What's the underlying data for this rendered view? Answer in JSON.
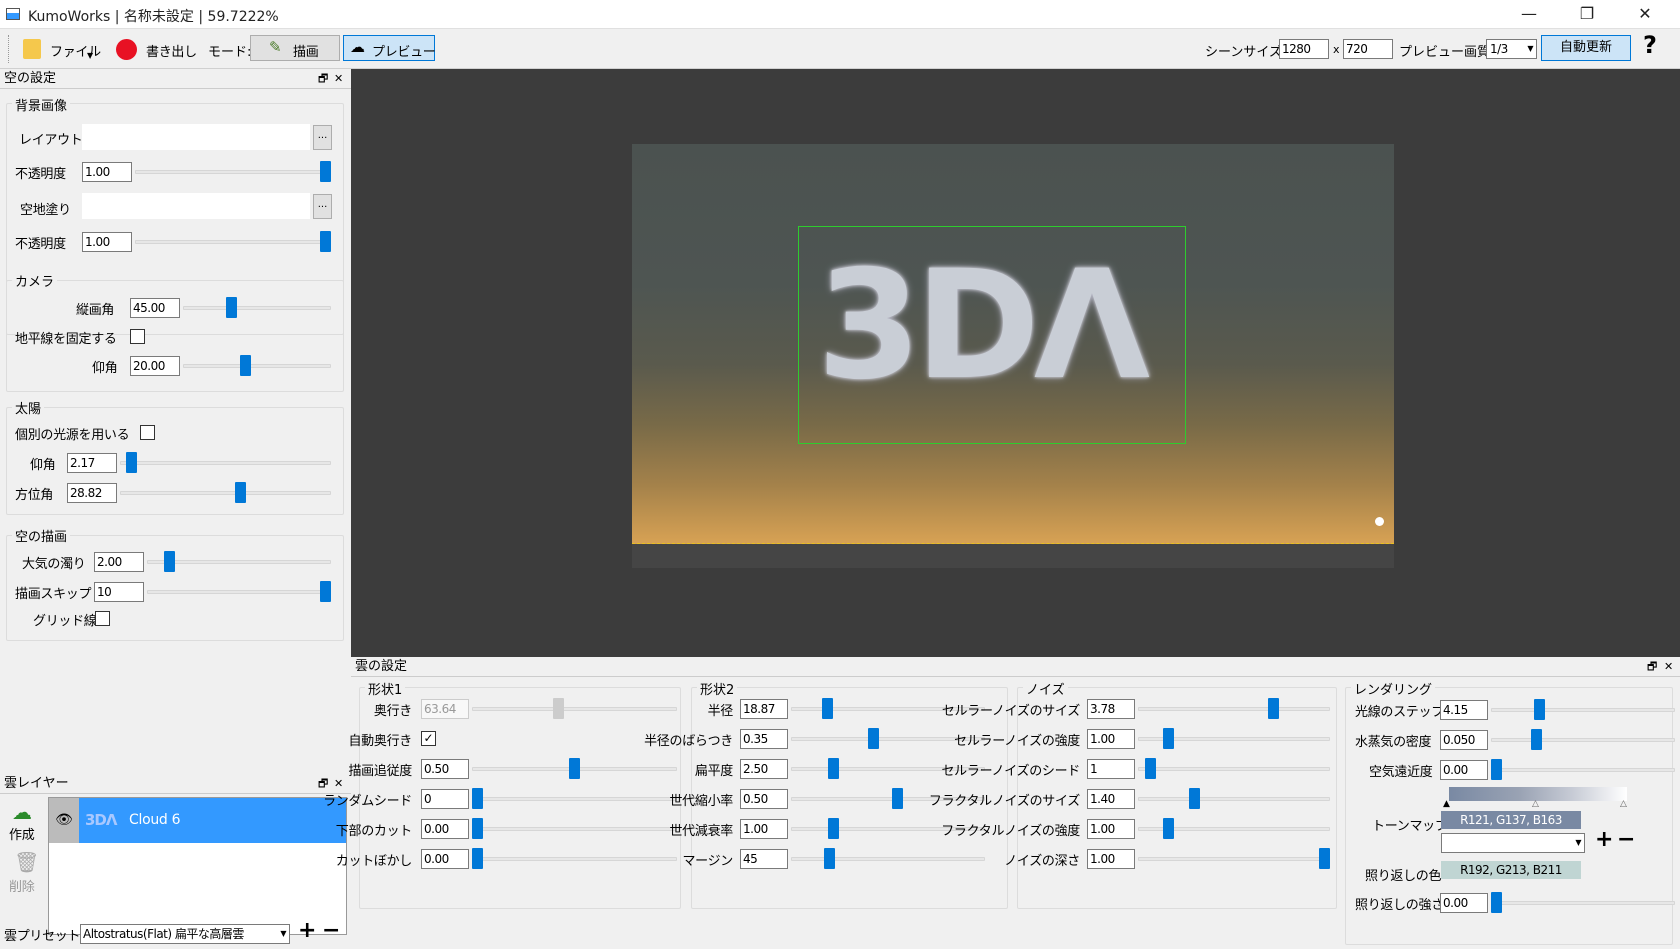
{
  "window": {
    "title": "KumoWorks | 名称未設定 | 59.7222%",
    "minimize": "—",
    "maximize": "❐",
    "close": "✕"
  },
  "toolbar": {
    "file": "ファイル",
    "export": "書き出し",
    "mode_label": "モード:",
    "draw": "描画",
    "preview": "プレビュー",
    "scene_size_label": "シーンサイズ:",
    "width": "1280",
    "x_sep": "x",
    "height": "720",
    "preview_quality_label": "プレビュー画質:",
    "preview_quality": "1/3",
    "auto_update": "自動更新",
    "help": "?"
  },
  "sky_panel": {
    "title": "空の設定",
    "background": {
      "title": "背景画像",
      "layout_label": "レイアウト",
      "layout_value": "",
      "browse": "...",
      "opacity_label": "不透明度",
      "opacity_value": "1.00",
      "opacity_level": 1.0,
      "ground_label": "空地塗り",
      "ground_value": "",
      "ground_opacity_label": "不透明度",
      "ground_opacity_value": "1.00",
      "ground_opacity_level": 1.0
    },
    "camera": {
      "title": "カメラ",
      "fov_label": "縦画角",
      "fov_value": "45.00",
      "fix_horizon_label": "地平線を固定する",
      "pitch_label": "仰角",
      "pitch_value": "20.00"
    },
    "sun": {
      "title": "太陽",
      "individual_light_label": "個別の光源を用いる",
      "elevation_label": "仰角",
      "elevation_value": "2.17",
      "azimuth_label": "方位角",
      "azimuth_value": "28.82"
    },
    "sky_render": {
      "title": "空の描画",
      "turbidity_label": "大気の濁り",
      "turbidity_value": "2.00",
      "skip_label": "描画スキップ",
      "skip_value": "10",
      "grid_label": "グリッド線"
    }
  },
  "layers_panel": {
    "title": "雲レイヤー",
    "create": "作成",
    "delete": "削除",
    "layers": [
      {
        "thumb": "3DΛ",
        "name": "Cloud 6"
      }
    ],
    "preset_label": "雲プリセット:",
    "preset_value": "Altostratus(Flat) 扁平な高層雲",
    "add": "+",
    "remove": "−"
  },
  "viewport": {
    "cloud_text": "3DΛ"
  },
  "cloud_panel": {
    "title": "雲の設定",
    "shape1": {
      "title": "形状1",
      "rows": [
        {
          "label": "奥行き",
          "value": "63.64",
          "level": 0.42,
          "disabled": true
        },
        {
          "label": "自動奥行き",
          "checkbox": true,
          "checked": true
        },
        {
          "label": "描画追従度",
          "value": "0.50",
          "level": 0.5
        },
        {
          "label": "ランダムシード",
          "value": "0",
          "level": 0.0
        },
        {
          "label": "下部のカット",
          "value": "0.00",
          "level": 0.0
        },
        {
          "label": "カットぼかし",
          "value": "0.00",
          "level": 0.0
        }
      ]
    },
    "shape2": {
      "title": "形状2",
      "rows": [
        {
          "label": "半径",
          "value": "18.87",
          "level": 0.17
        },
        {
          "label": "半径のばらつき",
          "value": "0.35",
          "level": 0.42
        },
        {
          "label": "扁平度",
          "value": "2.50",
          "level": 0.2
        },
        {
          "label": "世代縮小率",
          "value": "0.50",
          "level": 0.55
        },
        {
          "label": "世代減衰率",
          "value": "1.00",
          "level": 0.2
        },
        {
          "label": "マージン",
          "value": "45",
          "level": 0.18
        }
      ]
    },
    "noise": {
      "title": "ノイズ",
      "rows": [
        {
          "label": "セルラーノイズのサイズ",
          "value": "3.78",
          "level": 0.72
        },
        {
          "label": "セルラーノイズの強度",
          "value": "1.00",
          "level": 0.14
        },
        {
          "label": "セルラーノイズのシード",
          "value": "1",
          "level": 0.04
        },
        {
          "label": "フラクタルノイズのサイズ",
          "value": "1.40",
          "level": 0.28
        },
        {
          "label": "フラクタルノイズの強度",
          "value": "1.00",
          "level": 0.14
        },
        {
          "label": "ノイズの深さ",
          "value": "1.00",
          "level": 1.0
        }
      ]
    },
    "rendering": {
      "title": "レンダリング",
      "ray_step_label": "光線のステップ",
      "ray_step_value": "4.15",
      "ray_step_level": 0.22,
      "vapor_label": "水蒸気の密度",
      "vapor_value": "0.050",
      "vapor_level": 0.2,
      "aerial_label": "空気遠近度",
      "aerial_value": "0.00",
      "aerial_level": 0.0,
      "tonemap_label": "トーンマップ",
      "tonemap_color": "R121, G137, B163",
      "tonemap_hex": "#7989a3",
      "add": "+",
      "remove": "−",
      "reflect_color_label": "照り返しの色",
      "reflect_color": "R192, G213, B211",
      "reflect_hex": "#c0d5d3",
      "reflect_strength_label": "照り返しの強さ",
      "reflect_strength_value": "0.00",
      "reflect_strength_level": 0.0
    }
  }
}
